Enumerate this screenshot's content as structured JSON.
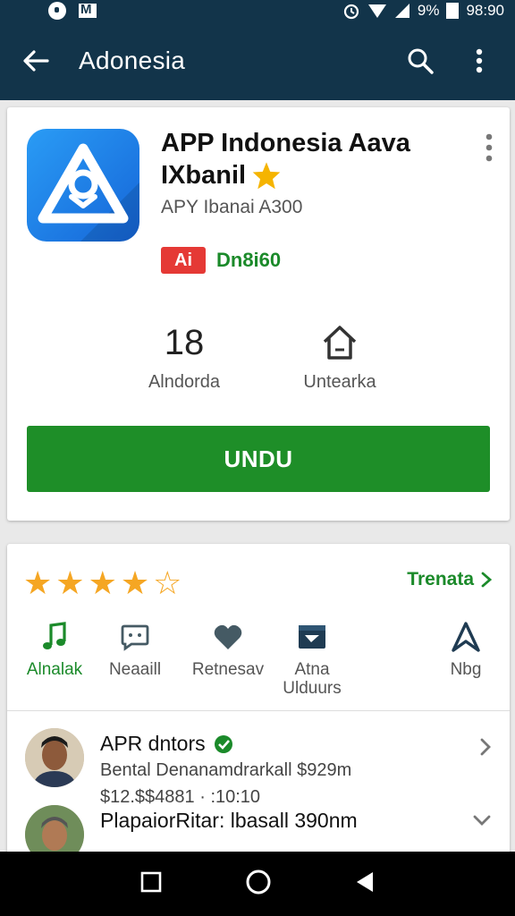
{
  "status_bar": {
    "battery": "9%",
    "time": "98:90"
  },
  "appbar": {
    "title": "Adonesia"
  },
  "app": {
    "name_line1": "APP Indonesia Aava",
    "name_line2": "IXbanil",
    "developer": "APY Ibanai A300",
    "badge": "Ai",
    "badge_text": "Dn8i60",
    "accent": "#1e8e28"
  },
  "stats": [
    {
      "value": "18",
      "label": "Alndorda"
    },
    {
      "value": "",
      "label": "Untearka"
    }
  ],
  "install_button": "UNDU",
  "ratings": {
    "stars_filled": 4,
    "stars_total": 5,
    "more_link": "Trenata"
  },
  "categories": [
    {
      "label": "Alnalak",
      "icon": "music-note-icon"
    },
    {
      "label": "Neaaill",
      "icon": "chat-icon"
    },
    {
      "label": "Retnesav",
      "icon": "heart-icon"
    },
    {
      "label": "Atna\nUlduurs",
      "icon": "send-box-icon"
    },
    {
      "label": "Nbg",
      "icon": "navigation-icon"
    }
  ],
  "reviews": [
    {
      "name": "APR dntors",
      "line": "Bental Denanamdrarkall $929m",
      "meta": "$12.$$4881 · :10:10"
    },
    {
      "name": "PlapaiorRitar: lbasall 390nm",
      "line": "",
      "meta": ""
    }
  ]
}
